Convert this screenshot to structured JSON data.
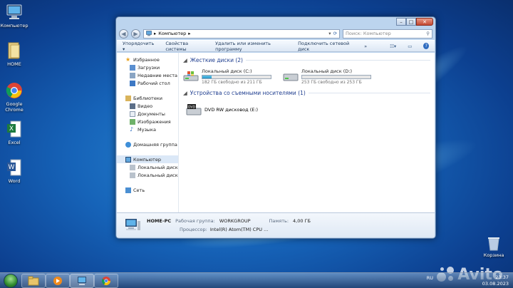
{
  "desktop": {
    "icons": [
      {
        "label": "Компьютер",
        "icon": "computer-icon"
      },
      {
        "label": "HOME",
        "icon": "folder-icon"
      },
      {
        "label": "Google Chrome",
        "icon": "chrome-icon"
      },
      {
        "label": "Excel",
        "icon": "excel-icon"
      },
      {
        "label": "Word",
        "icon": "word-icon"
      }
    ],
    "recycle_bin": "Корзина"
  },
  "window": {
    "address": {
      "root_arrow": "▸",
      "location": "Компьютер",
      "sep": "▸"
    },
    "search_placeholder": "Поиск: Компьютер",
    "toolbar": {
      "organize": "Упорядочить ▾",
      "system_props": "Свойства системы",
      "uninstall": "Удалить или изменить программу",
      "map_drive": "Подключить сетевой диск",
      "more": "»"
    },
    "nav": {
      "favorites": "Избранное",
      "downloads": "Загрузки",
      "recent": "Недавние места",
      "desktop": "Рабочий стол",
      "libraries": "Библиотеки",
      "video": "Видео",
      "documents": "Документы",
      "images": "Изображения",
      "music": "Музыка",
      "homegroup": "Домашняя группа",
      "computer": "Компьютер",
      "disk_c": "Локальный диск (C",
      "disk_d": "Локальный диск (D",
      "network": "Сеть"
    },
    "groups": {
      "hard_drives": "Жесткие диски (2)",
      "removable": "Устройства со съемными носителями (1)"
    },
    "drives": [
      {
        "name": "Локальный диск (C:)",
        "free": "182 ГБ свободно из 211 ГБ",
        "used_fraction": 0.14
      },
      {
        "name": "Локальный диск (D:)",
        "free": "253 ГБ свободно из 253 ГБ",
        "used_fraction": 0.0
      }
    ],
    "dvd": "DVD RW дисковод (E:)",
    "details": {
      "pc_name": "HOME-PC",
      "workgroup_label": "Рабочая группа:",
      "workgroup": "WORKGROUP",
      "memory_label": "Память:",
      "memory": "4,00 ГБ",
      "cpu_label": "Процессор:",
      "cpu": "Intel(R) Atom(TM) CPU ..."
    }
  },
  "taskbar": {
    "lang": "RU",
    "time": "23:37",
    "date": "03.08.2023"
  },
  "watermark": "Avito"
}
